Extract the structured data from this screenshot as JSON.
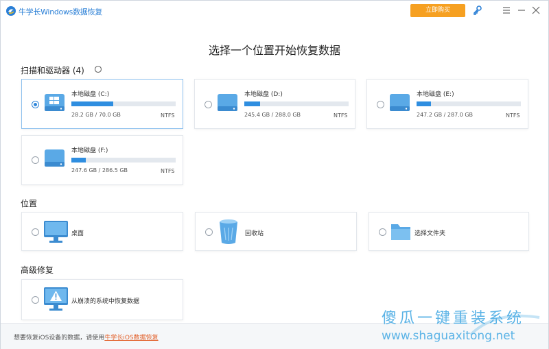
{
  "titlebar": {
    "app_title": "牛学长Windows数据恢复",
    "buy_label": "立即购买"
  },
  "heading": "选择一个位置开始恢复数据",
  "drives_section": {
    "title": "扫描和驱动器 (4)",
    "drives": [
      {
        "name": "本地磁盘 (C:)",
        "size": "28.2 GB / 70.0 GB",
        "fs": "NTFS",
        "used_fraction": 0.4,
        "selected": true
      },
      {
        "name": "本地磁盘 (D:)",
        "size": "245.4 GB / 288.0 GB",
        "fs": "NTFS",
        "used_fraction": 0.15,
        "selected": false
      },
      {
        "name": "本地磁盘 (E:)",
        "size": "247.2 GB / 287.0 GB",
        "fs": "NTFS",
        "used_fraction": 0.14,
        "selected": false
      },
      {
        "name": "本地磁盘 (F:)",
        "size": "247.6 GB / 286.5 GB",
        "fs": "NTFS",
        "used_fraction": 0.14,
        "selected": false
      }
    ]
  },
  "locations_section": {
    "title": "位置",
    "items": [
      {
        "label": "桌面",
        "icon": "monitor-icon"
      },
      {
        "label": "回收站",
        "icon": "recycle-bin-icon"
      },
      {
        "label": "选择文件夹",
        "icon": "folder-icon"
      }
    ]
  },
  "advanced_section": {
    "title": "高级修复",
    "items": [
      {
        "label": "从崩溃的系统中恢复数据",
        "icon": "warning-monitor-icon"
      }
    ]
  },
  "footer": {
    "text": "想要恢复iOS设备的数据，请使用",
    "link": "牛学长iOS数据恢复"
  },
  "watermark": {
    "line1": "傻瓜一键重装系统",
    "line2": "www.shaguaxitong.net"
  },
  "colors": {
    "accent": "#2f86d9",
    "buy": "#f6a021",
    "link": "#e2602a"
  }
}
